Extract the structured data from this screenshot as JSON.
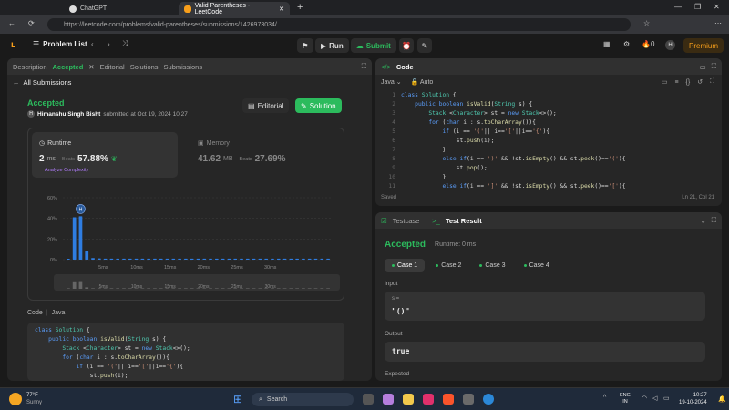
{
  "browser": {
    "tab1": "ChatGPT",
    "tab2": "Valid Parentheses - LeetCode",
    "url": "https://leetcode.com/problems/valid-parentheses/submissions/1426973034/"
  },
  "header": {
    "problem_list": "Problem List",
    "run": "Run",
    "submit": "Submit",
    "streak": "0",
    "avatar": "H",
    "premium": "Premium"
  },
  "left": {
    "tabs": [
      "Description",
      "Accepted",
      "Editorial",
      "Solutions",
      "Submissions"
    ],
    "back": "All Submissions",
    "status": "Accepted",
    "user": "Himanshu Singh Bisht",
    "submitted": "submitted at Oct 19, 2024 10:27",
    "editorial_btn": "Editorial",
    "solution_btn": "Solution",
    "runtime_label": "Runtime",
    "runtime_val": "2",
    "runtime_unit": "ms",
    "beats": "Beats",
    "runtime_pct": "57.88%",
    "analyze": "Analyze Complexity",
    "memory_label": "Memory",
    "memory_val": "41.62",
    "memory_unit": "MB",
    "memory_beats": "Beats",
    "memory_pct": "27.69%",
    "code_label": "Code",
    "lang": "Java"
  },
  "chart_data": {
    "type": "bar",
    "yticks": [
      "60%",
      "40%",
      "20%",
      "0%"
    ],
    "xticks": [
      "5ms",
      "10ms",
      "15ms",
      "20ms",
      "25ms",
      "30ms"
    ],
    "ylim": [
      0,
      60
    ],
    "values": [
      0.6,
      41,
      42,
      8,
      1.5,
      1.2,
      1,
      1,
      1,
      1,
      1,
      1,
      1,
      1,
      1,
      1,
      1,
      1,
      1,
      1,
      1,
      1,
      1,
      1,
      1,
      1,
      1,
      1,
      1,
      1,
      1,
      1,
      1,
      1,
      1,
      1,
      1,
      1,
      1,
      1,
      1,
      1,
      1
    ],
    "highlight_index": 2,
    "marker": "H"
  },
  "right": {
    "code_title": "Code",
    "lang": "Java",
    "mode": "Auto",
    "saved": "Saved",
    "pos": "Ln 21, Col 21",
    "testcase": "Testcase",
    "testresult": "Test Result",
    "accepted": "Accepted",
    "runtime": "Runtime: 0 ms",
    "cases": [
      "Case 1",
      "Case 2",
      "Case 3",
      "Case 4"
    ],
    "input_label": "Input",
    "s_label": "s =",
    "input_val": "\"()\"",
    "output_label": "Output",
    "output_val": "true",
    "expected_label": "Expected"
  },
  "taskbar": {
    "temp": "77°F",
    "weather": "Sunny",
    "search": "Search",
    "lang1": "ENG",
    "lang2": "IN",
    "time": "10:27",
    "date": "19-10-2024"
  }
}
